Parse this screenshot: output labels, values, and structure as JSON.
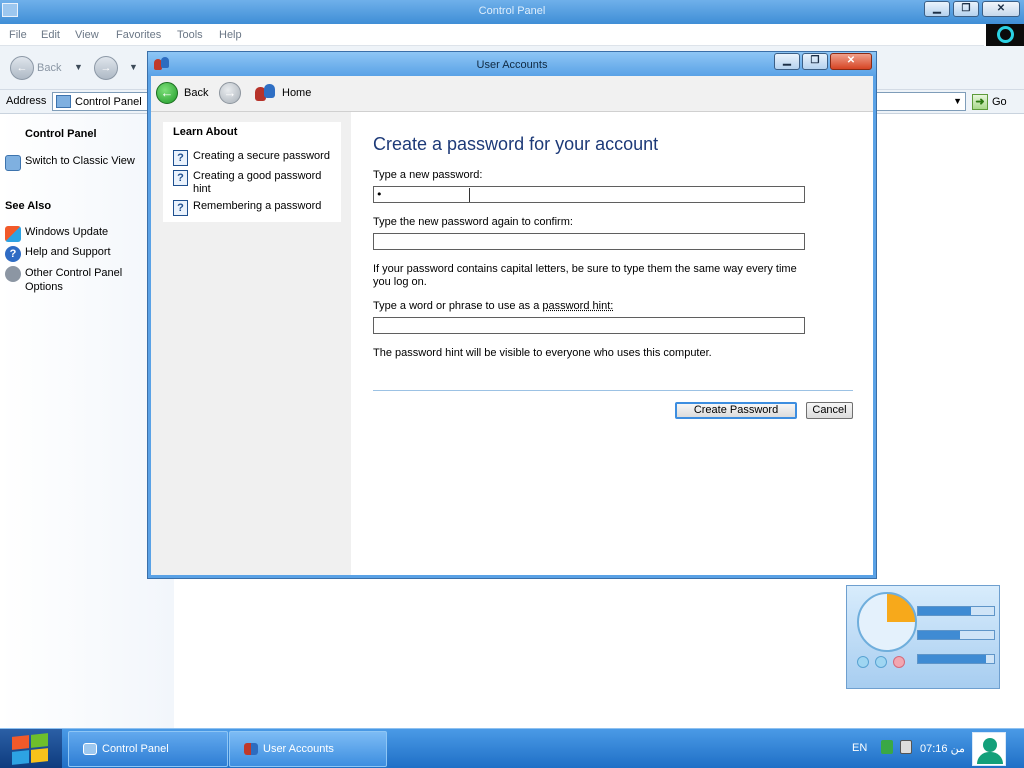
{
  "background_window": {
    "title": "Control Panel",
    "menu": [
      "File",
      "Edit",
      "View",
      "Favorites",
      "Tools",
      "Help"
    ],
    "toolbar": {
      "back_label": "Back"
    },
    "address": {
      "label": "Address",
      "value": "Control Panel",
      "go_label": "Go"
    },
    "sidebar": {
      "panel_title": "Control Panel",
      "switch_view": "Switch to Classic View",
      "see_also_title": "See Also",
      "see_also": [
        "Windows Update",
        "Help and Support",
        "Other Control Panel Options"
      ]
    }
  },
  "dialog": {
    "title": "User Accounts",
    "nav": {
      "back_label": "Back",
      "home_label": "Home"
    },
    "learn_about": {
      "title": "Learn About",
      "items": [
        "Creating a secure password",
        "Creating a good password hint",
        "Remembering a password"
      ]
    },
    "heading": "Create a password for your account",
    "new_password_label": "Type a new password:",
    "new_password_value": "•",
    "confirm_label": "Type the new password again to confirm:",
    "confirm_value": "",
    "capital_note": "If your password contains capital letters, be sure to type them the same way every time you log on.",
    "hint_label_prefix": "Type a word or phrase to use as a ",
    "hint_label_link": "password hint:",
    "hint_value": "",
    "hint_note": "The password hint will be visible to everyone who uses this computer.",
    "create_button": "Create Password",
    "cancel_button": "Cancel"
  },
  "taskbar": {
    "buttons": [
      "Control Panel",
      "User Accounts"
    ],
    "language": "EN",
    "clock": "07:16 من"
  },
  "colors": {
    "accent": "#1d3a78",
    "title_bar": "#5aa2e6",
    "taskbar": "#2f7ed4"
  }
}
